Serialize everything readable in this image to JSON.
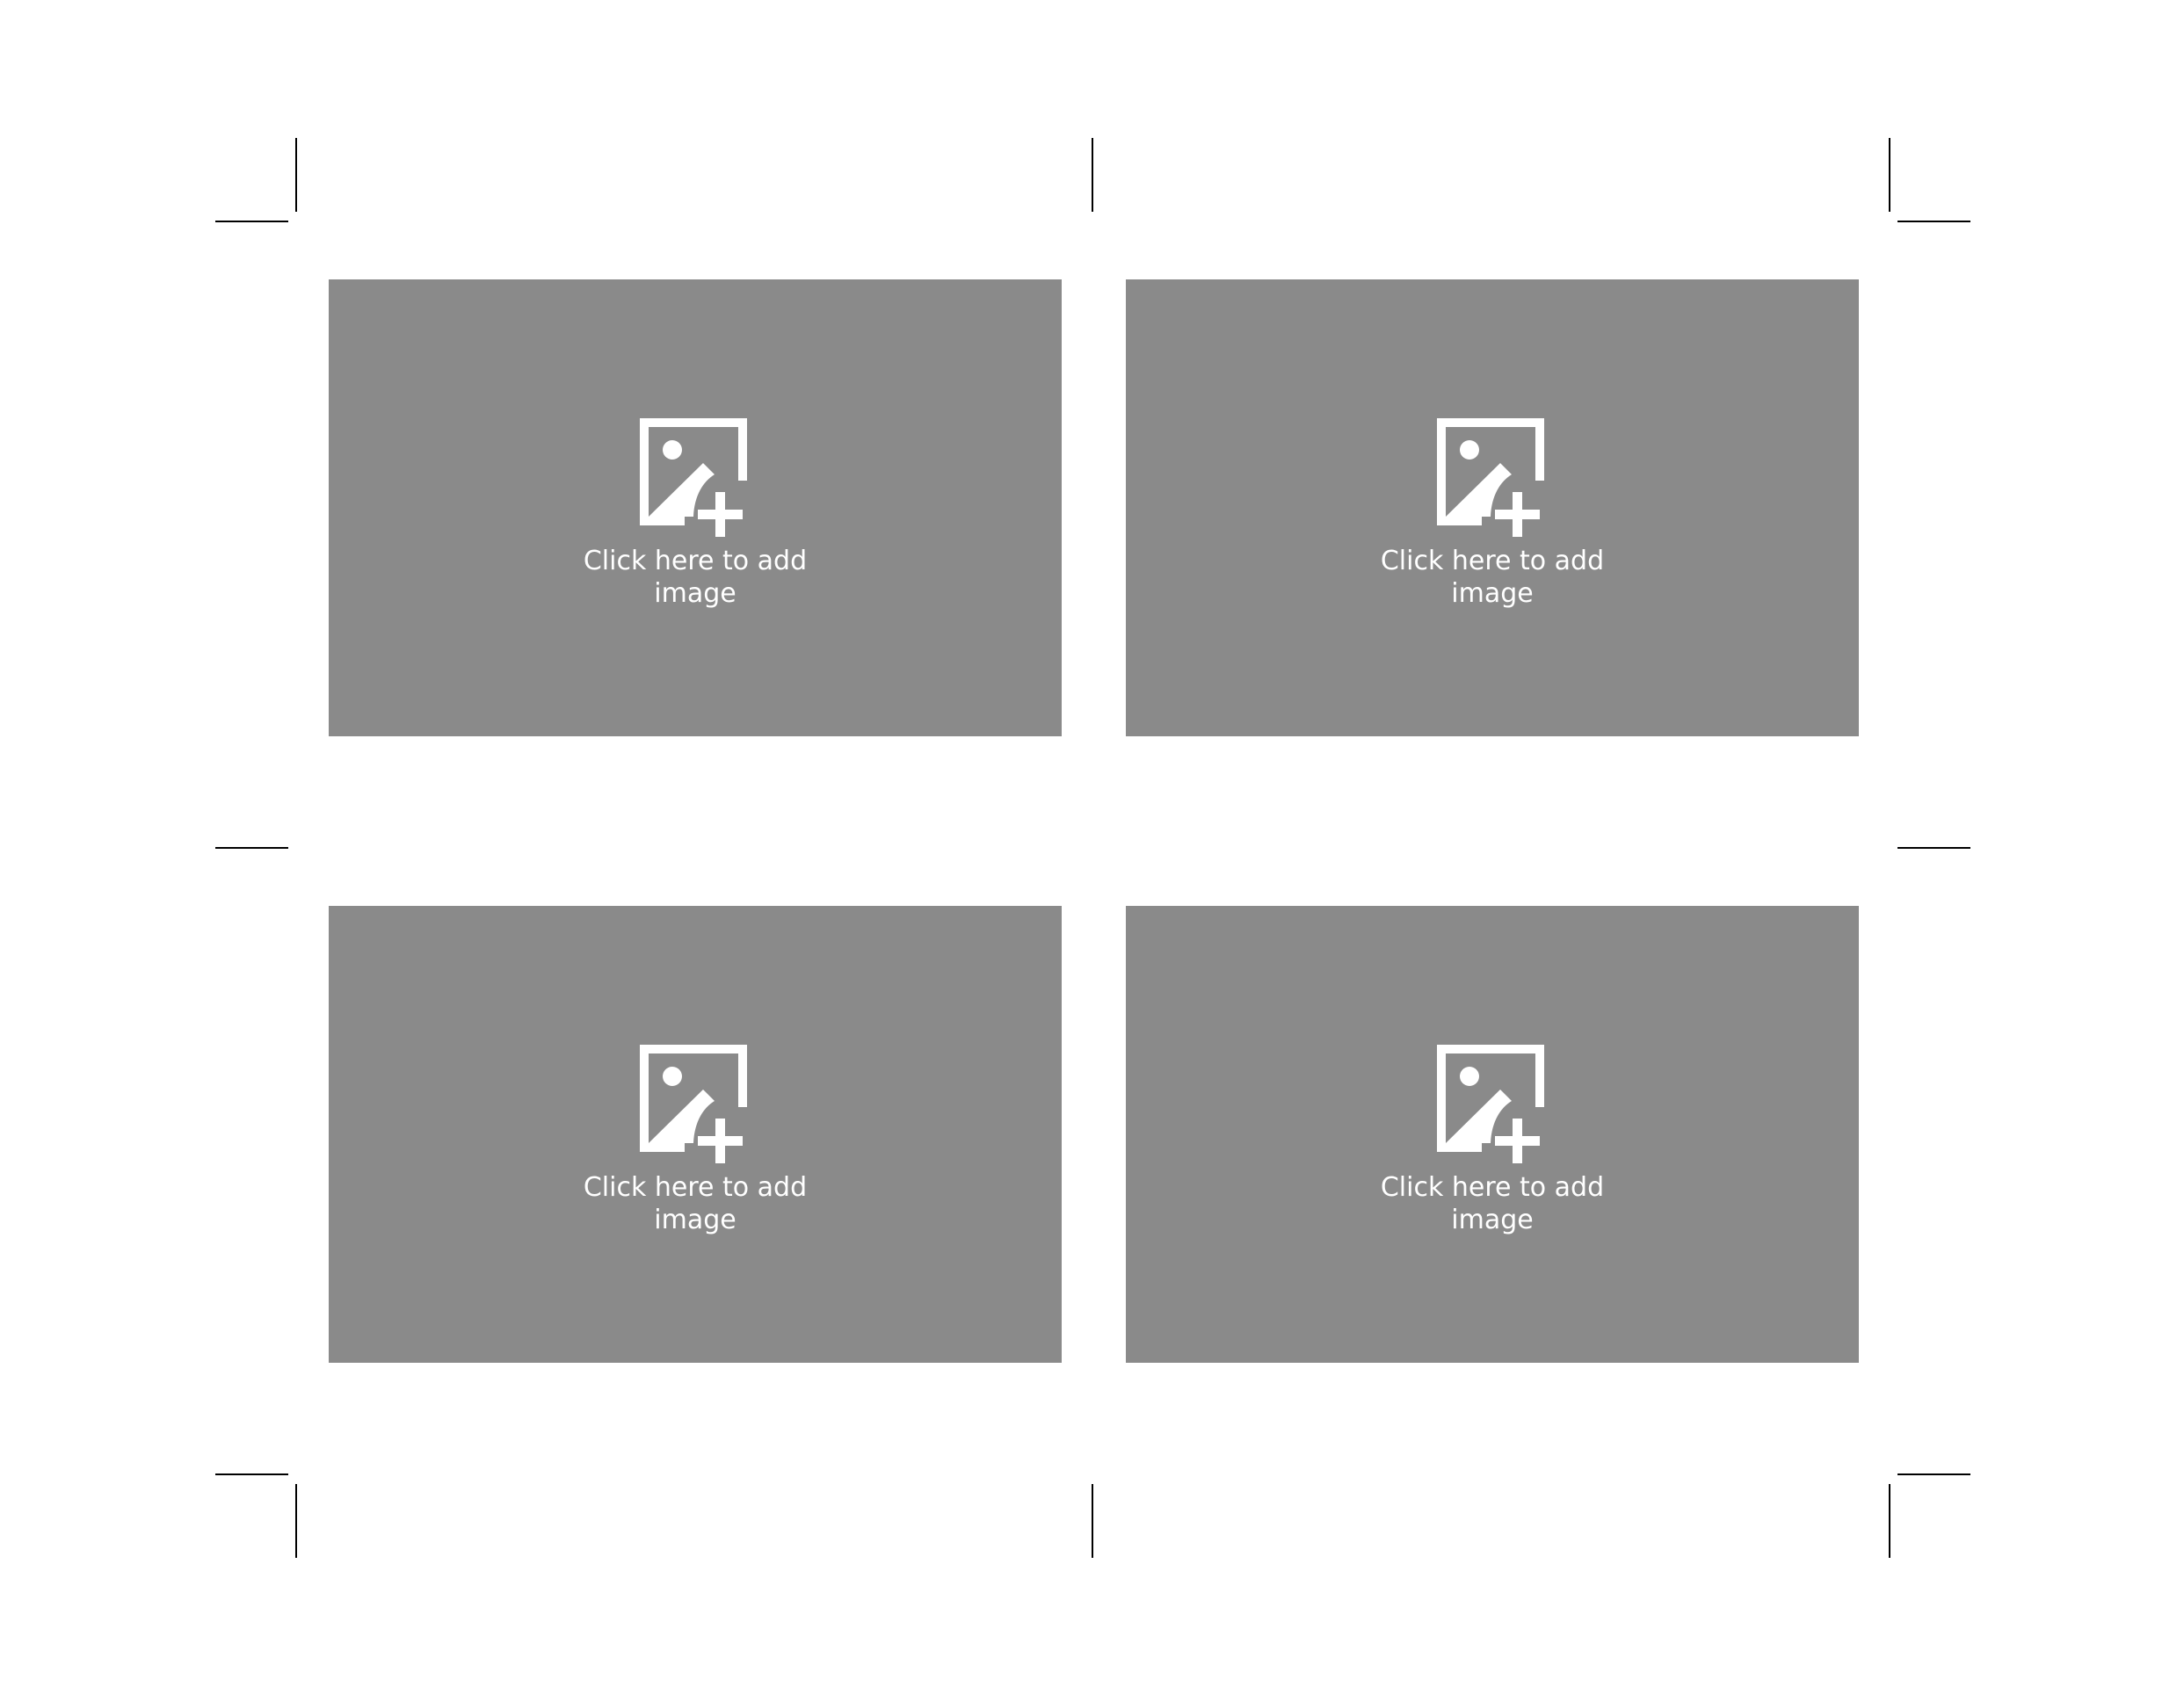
{
  "colors": {
    "placeholder_bg": "#8a8a8a",
    "placeholder_fg": "#ffffff",
    "crop_mark": "#000000"
  },
  "placeholders": [
    {
      "icon": "add-image-icon",
      "label": "Click here to add image"
    },
    {
      "icon": "add-image-icon",
      "label": "Click here to add image"
    },
    {
      "icon": "add-image-icon",
      "label": "Click here to add image"
    },
    {
      "icon": "add-image-icon",
      "label": "Click here to add image"
    }
  ]
}
